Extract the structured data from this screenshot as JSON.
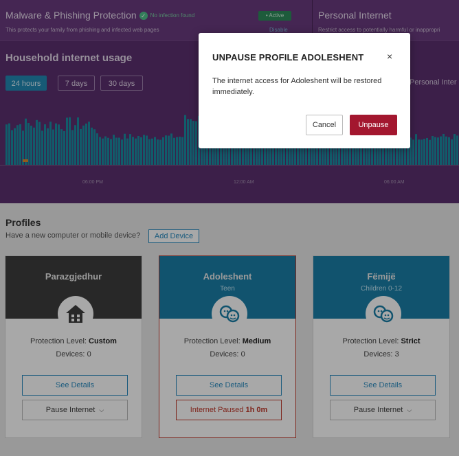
{
  "header": {
    "malware": {
      "title": "Malware & Phishing Protection",
      "status_text": "No infection found",
      "badge": "• Active",
      "description": "This protects your family from phishing and infected web pages",
      "action": "Disable"
    },
    "personal": {
      "title": "Personal Internet",
      "description": "Restrict access to potentially harmful or inappropri"
    }
  },
  "usage": {
    "title": "Household internet usage",
    "tabs": [
      "24 hours",
      "7 days",
      "30 days"
    ],
    "active_tab": "24 hours",
    "personal_label": "Personal Inter",
    "x_ticks": [
      "06:00 PM",
      "12:00 AM",
      "06:00 AM"
    ],
    "colors": {
      "bars": "#1a8ea3",
      "highlight": "#e08a2a",
      "background": "#5b2f6f"
    }
  },
  "profiles": {
    "title": "Profiles",
    "subtitle": "Have a new computer or mobile device?",
    "add_device": "Add Device",
    "cards": [
      {
        "name": "Parazgjedhur",
        "age": "",
        "protection_label": "Protection Level:",
        "protection_value": "Custom",
        "devices_label": "Devices:",
        "devices_value": "0",
        "details_label": "See Details",
        "action_label": "Pause Internet",
        "paused": false,
        "avatar_icon": "house-icon",
        "head_color": "#3d3d3d"
      },
      {
        "name": "Adoleshent",
        "age": "Teen",
        "protection_label": "Protection Level:",
        "protection_value": "Medium",
        "devices_label": "Devices:",
        "devices_value": "0",
        "details_label": "See Details",
        "action_label": "Internet Paused",
        "action_value": "1h 0m",
        "paused": true,
        "avatar_icon": "kids-icon",
        "head_color": "#1a7fa8"
      },
      {
        "name": "Fëmijë",
        "age": "Children 0-12",
        "protection_label": "Protection Level:",
        "protection_value": "Strict",
        "devices_label": "Devices:",
        "devices_value": "3",
        "details_label": "See Details",
        "action_label": "Pause Internet",
        "paused": false,
        "avatar_icon": "kids-icon",
        "head_color": "#1a7fa8"
      }
    ]
  },
  "modal": {
    "title": "UNPAUSE PROFILE ADOLESHENT",
    "close_glyph": "×",
    "body": "The internet access for Adoleshent will be restored immediately.",
    "cancel": "Cancel",
    "confirm": "Unpause",
    "confirm_color": "#a3172f"
  }
}
